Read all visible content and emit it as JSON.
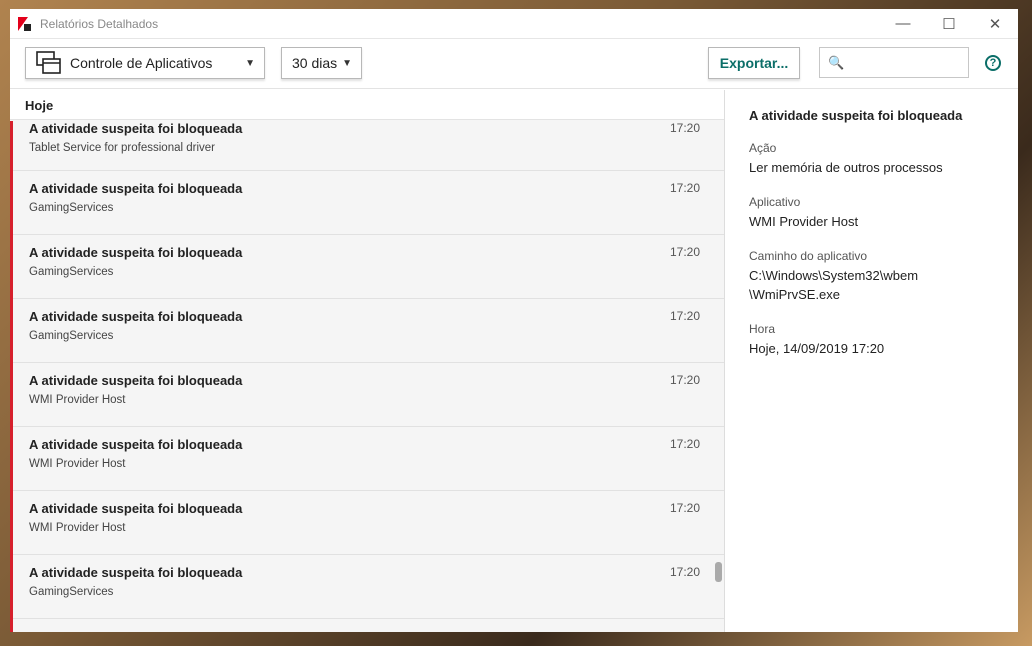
{
  "window": {
    "title": "Relatórios Detalhados",
    "minimize": "—",
    "maximize": "☐",
    "close": "✕"
  },
  "toolbar": {
    "report_type": "Controle de Aplicativos",
    "period": "30 dias",
    "export": "Exportar...",
    "search_placeholder": "",
    "help": "?"
  },
  "list": {
    "group": "Hoje",
    "items": [
      {
        "title": "A atividade suspeita foi bloqueada",
        "sub": "Tablet Service for professional driver",
        "time": "17:20"
      },
      {
        "title": "A atividade suspeita foi bloqueada",
        "sub": "GamingServices",
        "time": "17:20"
      },
      {
        "title": "A atividade suspeita foi bloqueada",
        "sub": "GamingServices",
        "time": "17:20"
      },
      {
        "title": "A atividade suspeita foi bloqueada",
        "sub": "GamingServices",
        "time": "17:20"
      },
      {
        "title": "A atividade suspeita foi bloqueada",
        "sub": "WMI Provider Host",
        "time": "17:20"
      },
      {
        "title": "A atividade suspeita foi bloqueada",
        "sub": "WMI Provider Host",
        "time": "17:20"
      },
      {
        "title": "A atividade suspeita foi bloqueada",
        "sub": "WMI Provider Host",
        "time": "17:20"
      },
      {
        "title": "A atividade suspeita foi bloqueada",
        "sub": "GamingServices",
        "time": "17:20"
      }
    ]
  },
  "detail": {
    "title": "A atividade suspeita foi bloqueada",
    "action_label": "Ação",
    "action": "Ler memória de outros processos",
    "app_label": "Aplicativo",
    "app": "WMI Provider Host",
    "path_label": "Caminho do aplicativo",
    "path1": "C:\\Windows\\System32\\wbem",
    "path2": "\\WmiPrvSE.exe",
    "time_label": "Hora",
    "time": "Hoje, 14/09/2019 17:20"
  }
}
